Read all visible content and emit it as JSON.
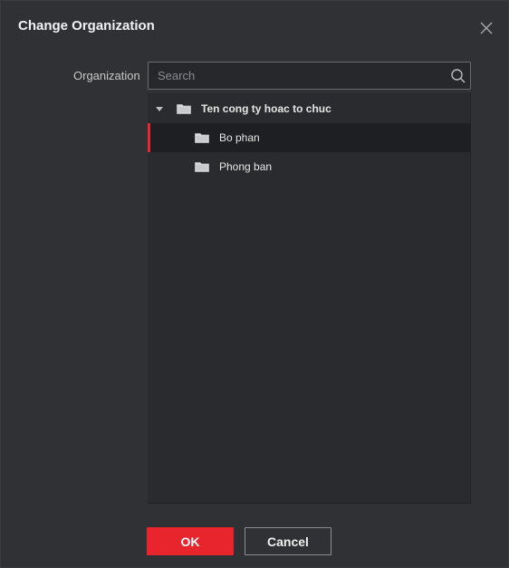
{
  "dialog": {
    "title": "Change Organization",
    "close_icon": "close-icon"
  },
  "form": {
    "organization_label": "Organization",
    "search": {
      "placeholder": "Search",
      "value": "",
      "icon": "search-icon"
    }
  },
  "tree": {
    "root": {
      "label": "Ten cong ty hoac to chuc",
      "expanded": true,
      "icon": "folder-icon"
    },
    "children": [
      {
        "label": "Bo phan",
        "selected": true,
        "icon": "folder-icon"
      },
      {
        "label": "Phong ban",
        "selected": false,
        "icon": "folder-icon"
      }
    ]
  },
  "footer": {
    "ok_label": "OK",
    "cancel_label": "Cancel"
  },
  "colors": {
    "accent": "#e8242d",
    "background": "#303134",
    "panel": "#2a2b2e"
  }
}
